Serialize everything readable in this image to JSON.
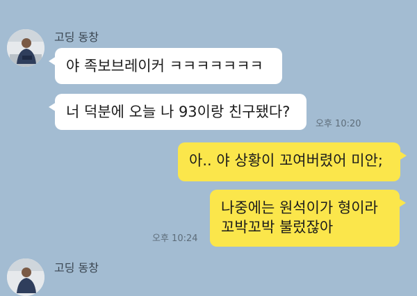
{
  "colors": {
    "background": "#a3bcd2",
    "incoming_bubble": "#ffffff",
    "outgoing_bubble": "#fbe64b",
    "timestamp": "#5d6c79"
  },
  "messages": {
    "first_group": {
      "sender": "고딩 동창",
      "avatar_icon": "profile-avatar",
      "lines": [
        "야 족보브레이커 ㅋㅋㅋㅋㅋㅋㅋ",
        "너 덕분에 오늘 나 93이랑 친구됐다?"
      ],
      "time": "오후 10:20"
    },
    "reply_group": {
      "lines": [
        "아.. 야 상황이 꼬여버렸어 미안;",
        "나중에는 원석이가 형이라",
        "꼬박꼬박 불렀잖아"
      ],
      "time": "오후 10:24"
    },
    "second_group": {
      "sender": "고딩 동창",
      "avatar_icon": "profile-avatar"
    }
  }
}
